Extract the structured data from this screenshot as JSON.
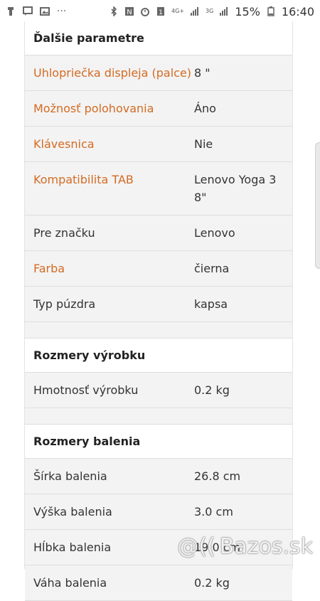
{
  "status_bar": {
    "left_icons": [
      "usb-icon",
      "message-icon",
      "image-icon",
      "more-icon"
    ],
    "more": "···",
    "network_label_1": "4G+",
    "network_label_2": "3G",
    "battery_percent": "15%",
    "time": "16:40"
  },
  "sections": [
    {
      "title": "Ďalšie parametre",
      "rows": [
        {
          "label": "Uhlopriečka displeja (palce)",
          "value": "8 \"",
          "highlight": true
        },
        {
          "label": "Možnosť polohovania",
          "value": "Áno",
          "highlight": true
        },
        {
          "label": "Klávesnica",
          "value": "Nie",
          "highlight": true
        },
        {
          "label": "Kompatibilita TAB",
          "value": "Lenovo Yoga 3 8\"",
          "highlight": true
        },
        {
          "label": "Pre značku",
          "value": "Lenovo",
          "highlight": false
        },
        {
          "label": "Farba",
          "value": "čierna",
          "highlight": true
        },
        {
          "label": "Typ púzdra",
          "value": "kapsa",
          "highlight": false
        }
      ]
    },
    {
      "title": "Rozmery výrobku",
      "rows": [
        {
          "label": "Hmotnosť výrobku",
          "value": "0.2 kg",
          "highlight": false
        }
      ]
    },
    {
      "title": "Rozmery balenia",
      "rows": [
        {
          "label": "Šírka balenia",
          "value": "26.8 cm",
          "highlight": false
        },
        {
          "label": "Výška balenia",
          "value": "3.0 cm",
          "highlight": false
        },
        {
          "label": "Hĺbka balenia",
          "value": "19.0 cm",
          "highlight": false
        },
        {
          "label": "Váha balenia",
          "value": "0.2 kg",
          "highlight": false
        }
      ]
    }
  ],
  "watermark": {
    "text": "Bazos.sk",
    "logo": "@(("
  },
  "colors": {
    "accent": "#d36b22"
  }
}
